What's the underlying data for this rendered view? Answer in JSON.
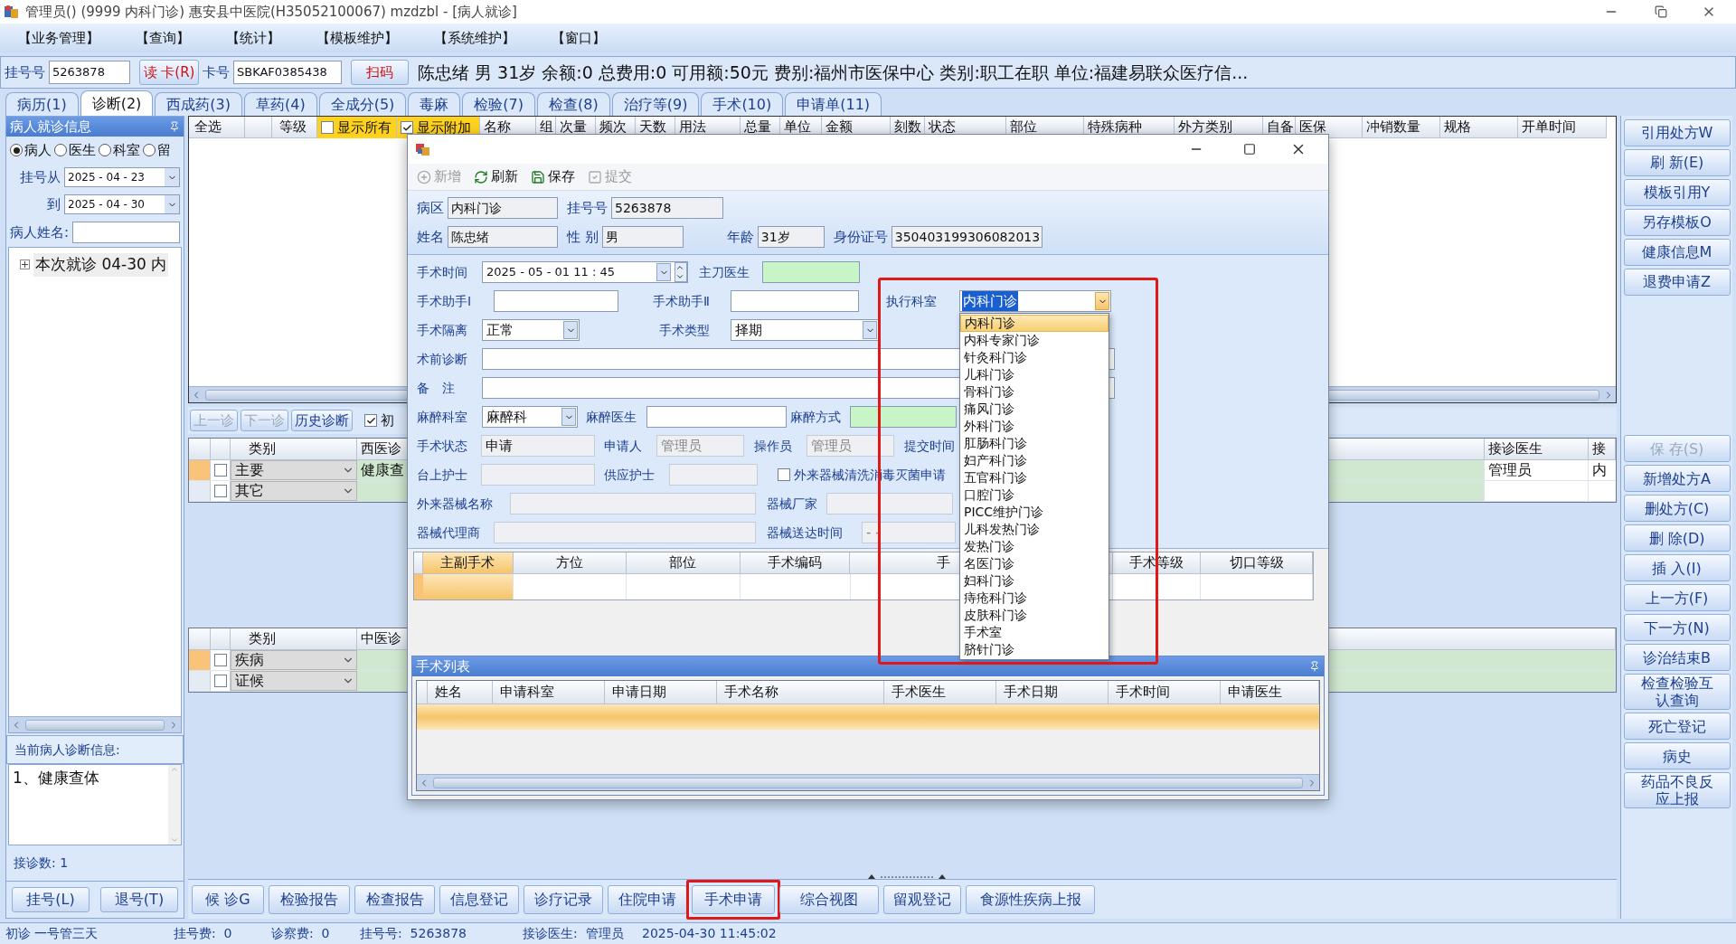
{
  "window": {
    "title": "管理员() (9999 内科门诊) 惠安县中医院(H35052100067) mzdzbl - [病人就诊]"
  },
  "menu": [
    "【业务管理】",
    "【查询】",
    "【统计】",
    "【模板维护】",
    "【系统维护】",
    "【窗口】"
  ],
  "patient_bar": {
    "reg_label": "挂号号",
    "reg_value": "5263878",
    "read_card": "读 卡(R)",
    "card_label": "卡号",
    "card_value": "SBKAF0385438",
    "scan": "扫码",
    "summary": "陈忠绪 男 31岁 余额:0 总费用:0 可用额:50元 费别:福州市医保中心 类别:职工在职 单位:福建易联众医疗信..."
  },
  "tabs": [
    {
      "label": "病历(1)",
      "selected": false
    },
    {
      "label": "诊断(2)",
      "selected": true
    },
    {
      "label": "西成药(3)",
      "selected": false
    },
    {
      "label": "草药(4)",
      "selected": false
    },
    {
      "label": "全成分(5)",
      "selected": false
    },
    {
      "label": "毒麻",
      "selected": false
    },
    {
      "label": "检验(7)",
      "selected": false
    },
    {
      "label": "检查(8)",
      "selected": false
    },
    {
      "label": "治疗等(9)",
      "selected": false
    },
    {
      "label": "手术(10)",
      "selected": false
    },
    {
      "label": "申请单(11)",
      "selected": false
    }
  ],
  "left_panel": {
    "title": "病人就诊信息",
    "radios": [
      {
        "label": "病人",
        "selected": true
      },
      {
        "label": "医生",
        "selected": false
      },
      {
        "label": "科室",
        "selected": false
      },
      {
        "label": "留",
        "selected": false
      }
    ],
    "date_from_label": "挂号从",
    "date_from": "2025 - 04 - 23",
    "date_to_label": "到",
    "date_to": "2025 - 04 - 30",
    "name_label": "病人姓名:",
    "tree": [
      {
        "label": "本次就诊 04-30 内",
        "expanded": false
      }
    ],
    "diag_title": "当前病人诊断信息:",
    "diag_text": "1、健康查体",
    "visit_count": "接诊数: 1",
    "buttons": [
      "挂号(L)",
      "退号(T)"
    ]
  },
  "order_grid": {
    "lead_columns": [
      "全选",
      "等级"
    ],
    "checks": [
      {
        "label": "显示所有",
        "checked": false
      },
      {
        "label": "显示附加",
        "checked": true
      }
    ],
    "columns": [
      "名称",
      "组",
      "次量",
      "频次",
      "天数",
      "用法",
      "总量",
      "单位",
      "金额",
      "刻数",
      "状态",
      "部位",
      "特殊病种",
      "外方类别",
      "自备",
      "医保",
      "冲销数量",
      "规格",
      "开单时间"
    ]
  },
  "diag_toolbar": {
    "buttons": [
      {
        "label": "上一诊",
        "disabled": true
      },
      {
        "label": "下一诊",
        "disabled": true
      },
      {
        "label": "历史诊断",
        "disabled": false
      }
    ],
    "check": {
      "label": "初",
      "checked": true
    }
  },
  "western_grid": {
    "columns": [
      "类别",
      "西医诊",
      "接诊医生",
      "接"
    ],
    "rows": [
      {
        "selected": true,
        "checked": false,
        "category": "主要",
        "diagnosis": "健康查",
        "doctor": "管理员",
        "column_4": "内"
      },
      {
        "selected": false,
        "checked": false,
        "category": "其它"
      }
    ]
  },
  "tcm_grid": {
    "columns": [
      "类别",
      "中医诊"
    ],
    "rows": [
      {
        "selected": true,
        "checked": false,
        "category": "疾病"
      },
      {
        "selected": false,
        "checked": false,
        "category": "证候"
      }
    ]
  },
  "right_buttons_top": [
    {
      "label": "引用处方W",
      "disabled": false
    },
    {
      "label": "刷 新(E)",
      "disabled": false
    },
    {
      "label": "模板引用Y",
      "disabled": false
    },
    {
      "label": "另存模板O",
      "disabled": false
    },
    {
      "label": "健康信息M",
      "disabled": false
    },
    {
      "label": "退费申请Z",
      "disabled": false
    }
  ],
  "right_buttons_bottom": [
    {
      "label": "保 存(S)",
      "disabled": true
    },
    {
      "label": "新增处方A",
      "disabled": false
    },
    {
      "label": "删处方(C)",
      "disabled": false
    },
    {
      "label": "删 除(D)",
      "disabled": false
    },
    {
      "label": "插 入(I)",
      "disabled": false
    },
    {
      "label": "上一方(F)",
      "disabled": false
    },
    {
      "label": "下一方(N)",
      "disabled": false
    },
    {
      "label": "诊治结束B",
      "disabled": false
    },
    {
      "label": "检查检验互认查询",
      "disabled": false
    },
    {
      "label": "死亡登记",
      "disabled": false
    },
    {
      "label": "病史",
      "disabled": false
    },
    {
      "label": "药品不良反应上报",
      "disabled": false
    }
  ],
  "bottom_buttons": [
    {
      "label": "候 诊G",
      "annotated": false
    },
    {
      "label": "检验报告",
      "annotated": false
    },
    {
      "label": "检查报告",
      "annotated": false
    },
    {
      "label": "信息登记",
      "annotated": false
    },
    {
      "label": "诊疗记录",
      "annotated": false
    },
    {
      "label": "住院申请",
      "annotated": false
    },
    {
      "label": "手术申请",
      "annotated": true
    },
    {
      "label": "综合视图",
      "annotated": false
    },
    {
      "label": "留观登记",
      "annotated": false
    },
    {
      "label": "食源性疾病上报",
      "annotated": false
    }
  ],
  "status_bar": [
    "初诊 一号管三天",
    "挂号费:  0",
    "诊察费:  0",
    "挂号号:  5263878",
    "接诊医生:  管理员",
    "2025-04-30 11:45:02"
  ],
  "dialog": {
    "toolbar": [
      {
        "label": "新增",
        "disabled": true
      },
      {
        "label": "刷新",
        "disabled": false
      },
      {
        "label": "保存",
        "disabled": false
      },
      {
        "label": "提交",
        "disabled": true
      }
    ],
    "info_rows": [
      [
        {
          "label": "病区",
          "value": "内科门诊"
        },
        {
          "label": "挂号号",
          "value": "5263878"
        }
      ],
      [
        {
          "label": "姓名",
          "value": "陈忠绪"
        },
        {
          "label": "性 别",
          "value": "男"
        },
        {
          "label": "年龄",
          "value": "31岁"
        },
        {
          "label": "身份证号",
          "value": "350403199306082013"
        }
      ]
    ],
    "form_rows": [
      [
        {
          "kind": "datetime",
          "label": "手术时间",
          "value": "2025 - 05 - 01   11 : 45"
        },
        {
          "kind": "required",
          "label": "主刀医生"
        }
      ],
      [
        {
          "kind": "text",
          "label": "手术助手Ⅰ"
        },
        {
          "kind": "text",
          "label": "手术助手Ⅱ"
        },
        {
          "kind": "dropdown",
          "label": "执行科室",
          "value": "内科门诊",
          "annotated": true
        }
      ],
      [
        {
          "kind": "combo",
          "label": "手术隔离",
          "value": "正常"
        },
        {
          "kind": "combo",
          "label": "手术类型",
          "value": "择期"
        }
      ],
      [
        {
          "kind": "text",
          "label": "术前诊断"
        }
      ],
      [
        {
          "kind": "text",
          "label": "备　注"
        }
      ],
      [
        {
          "kind": "combo",
          "label": "麻醉科室",
          "value": "麻醉科"
        },
        {
          "kind": "text",
          "label": "麻醉医生"
        },
        {
          "kind": "required",
          "label": "麻醉方式"
        }
      ],
      [
        {
          "kind": "readonly",
          "label": "手术状态",
          "value": "申请"
        },
        {
          "kind": "readonly",
          "label": "申请人",
          "value": "管理员"
        },
        {
          "kind": "readonly",
          "label": "操作员",
          "value": "管理员"
        },
        {
          "kind": "label",
          "label": "提交时间"
        }
      ],
      [
        {
          "kind": "readonly",
          "label": "台上护士"
        },
        {
          "kind": "readonly",
          "label": "供应护士"
        },
        {
          "kind": "check",
          "label": "外来器械清洗消毒灭菌申请",
          "checked": false
        }
      ],
      [
        {
          "kind": "readonly",
          "label": "外来器械名称"
        },
        {
          "kind": "readonly",
          "label": "器械厂家"
        }
      ],
      [
        {
          "kind": "readonly",
          "label": "器械代理商"
        },
        {
          "kind": "readonly",
          "label": "器械送达时间",
          "value": "-    -"
        }
      ]
    ],
    "dept_options": [
      {
        "label": "内科门诊",
        "selected": true
      },
      {
        "label": "内科专家门诊",
        "selected": false
      },
      {
        "label": "针灸科门诊",
        "selected": false
      },
      {
        "label": "儿科门诊",
        "selected": false
      },
      {
        "label": "骨科门诊",
        "selected": false
      },
      {
        "label": "痛风门诊",
        "selected": false
      },
      {
        "label": "外科门诊",
        "selected": false
      },
      {
        "label": "肛肠科门诊",
        "selected": false
      },
      {
        "label": "妇产科门诊",
        "selected": false
      },
      {
        "label": "五官科门诊",
        "selected": false
      },
      {
        "label": "口腔门诊",
        "selected": false
      },
      {
        "label": "PICC维护门诊",
        "selected": false
      },
      {
        "label": "儿科发热门诊",
        "selected": false
      },
      {
        "label": "发热门诊",
        "selected": false
      },
      {
        "label": "名医门诊",
        "selected": false
      },
      {
        "label": "妇科门诊",
        "selected": false
      },
      {
        "label": "痔疮科门诊",
        "selected": false
      },
      {
        "label": "皮肤科门诊",
        "selected": false
      },
      {
        "label": "手术室",
        "selected": false
      },
      {
        "label": "脐针门诊",
        "selected": false
      }
    ],
    "surgery_grid": {
      "columns": [
        {
          "label": "主副手术",
          "selected": true
        },
        {
          "label": "方位",
          "selected": false
        },
        {
          "label": "部位",
          "selected": false
        },
        {
          "label": "手术编码",
          "selected": false
        },
        {
          "label": "手",
          "selected": false
        },
        {
          "label": "手术等级",
          "selected": false
        },
        {
          "label": "切口等级",
          "selected": false
        }
      ]
    },
    "list_panel": {
      "title": "手术列表",
      "columns": [
        "姓名",
        "申请科室",
        "申请日期",
        "手术名称",
        "手术医生",
        "手术日期",
        "手术时间",
        "申请医生"
      ],
      "rows": [
        {
          "selected": true
        }
      ]
    }
  }
}
